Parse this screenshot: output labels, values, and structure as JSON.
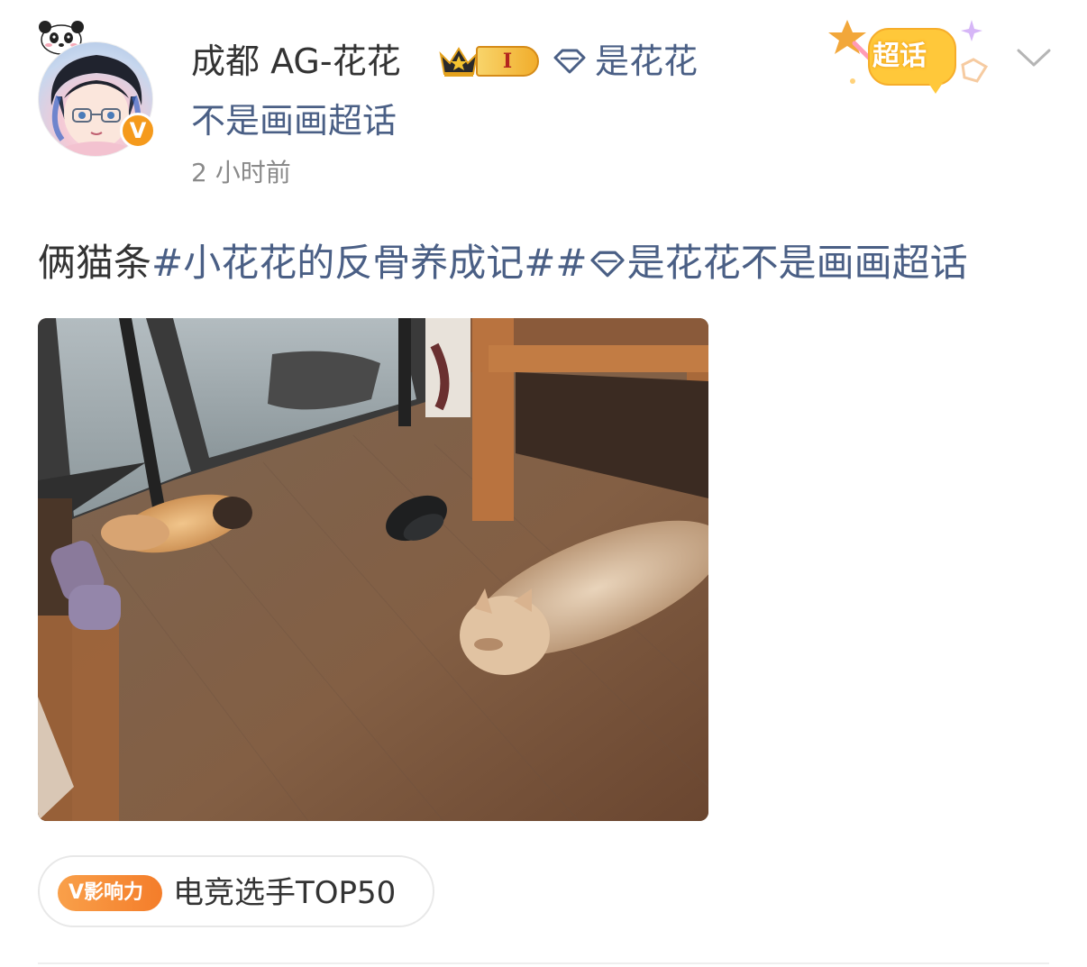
{
  "author": {
    "name": "成都 AG-花花",
    "level_badge": "I",
    "verified_badge": "V",
    "avatar_icon": "anime-avatar",
    "crown_icon": "crown-icon",
    "diamond_icon": "diamond-icon"
  },
  "header": {
    "topic_part1": "是花花",
    "topic_part2": "不是画画超话",
    "timestamp": "2 小时前",
    "supertopic_label": "超话",
    "menu_icon": "chevron-down-icon"
  },
  "post": {
    "text_plain": "俩猫条",
    "tag_1": "#小花花的反骨养成记#",
    "tag_2": "是花花不是画画超话",
    "image_icon": "photo-two-cats-on-floor"
  },
  "influence": {
    "badge": "V影响力",
    "text": "电竞选手TOP50"
  },
  "colors": {
    "link": "#4a5f85",
    "text": "#333333",
    "muted": "#8a8a8a",
    "accent_orange": "#f47d2a",
    "verified_gold": "#f59a1c"
  }
}
